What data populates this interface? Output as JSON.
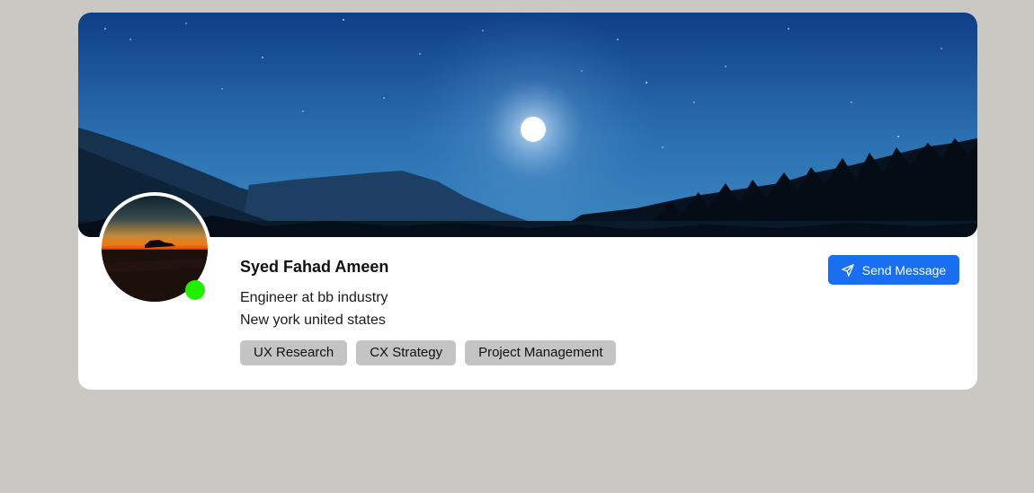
{
  "profile": {
    "name": "Syed Fahad Ameen",
    "role": "Engineer at bb industry",
    "location": "New york united states",
    "online": true,
    "tags": [
      "UX Research",
      "CX Strategy",
      "Project Management"
    ]
  },
  "actions": {
    "send_message_label": "Send Message",
    "send_icon": "paper-plane-icon"
  },
  "colors": {
    "page_background": "#cac8c3",
    "card_background": "#ffffff",
    "accent": "#1a6ff0",
    "status_online": "#22ee00",
    "tag_background": "#c4c4c4"
  }
}
